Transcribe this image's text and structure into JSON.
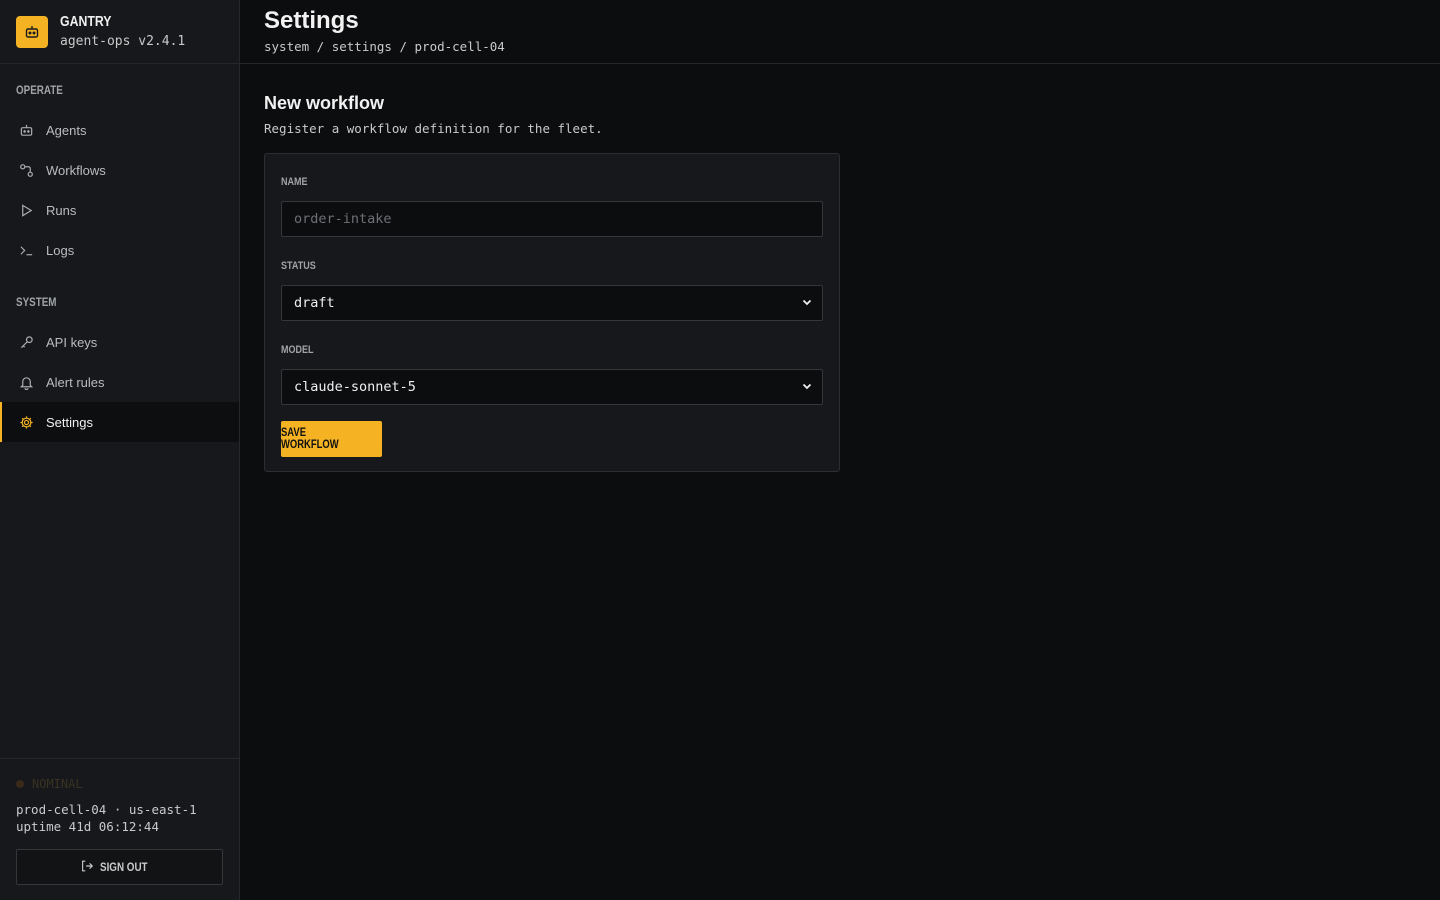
{
  "brand": {
    "name": "GANTRY",
    "version": "agent-ops v2.4.1"
  },
  "sidebar": {
    "operate_heading": "OPERATE",
    "operate_items": [
      {
        "label": "Agents",
        "icon": "robot-icon"
      },
      {
        "label": "Workflows",
        "icon": "workflow-icon"
      },
      {
        "label": "Runs",
        "icon": "play-icon"
      },
      {
        "label": "Logs",
        "icon": "terminal-icon"
      }
    ],
    "system_heading": "SYSTEM",
    "system_items": [
      {
        "label": "API keys",
        "icon": "key-icon"
      },
      {
        "label": "Alert rules",
        "icon": "bell-icon"
      },
      {
        "label": "Settings",
        "icon": "gear-icon",
        "active": true
      }
    ],
    "footer": {
      "status": "NOMINAL",
      "cell": "prod-cell-04 · us-east-1",
      "uptime": "uptime 41d 06:12:44",
      "signout_label": "SIGN OUT"
    }
  },
  "header": {
    "title": "Settings",
    "breadcrumb": "system / settings / prod-cell-04"
  },
  "form": {
    "title": "New workflow",
    "description": "Register a workflow definition for the fleet.",
    "name_label": "NAME",
    "name_placeholder": "order-intake",
    "status_label": "STATUS",
    "status_value": "draft",
    "model_label": "MODEL",
    "model_value": "claude-sonnet-5",
    "save_label": "SAVE WORKFLOW"
  },
  "colors": {
    "accent": "#f5b324",
    "background": "#0c0d0f",
    "sidebar": "#16181b"
  }
}
